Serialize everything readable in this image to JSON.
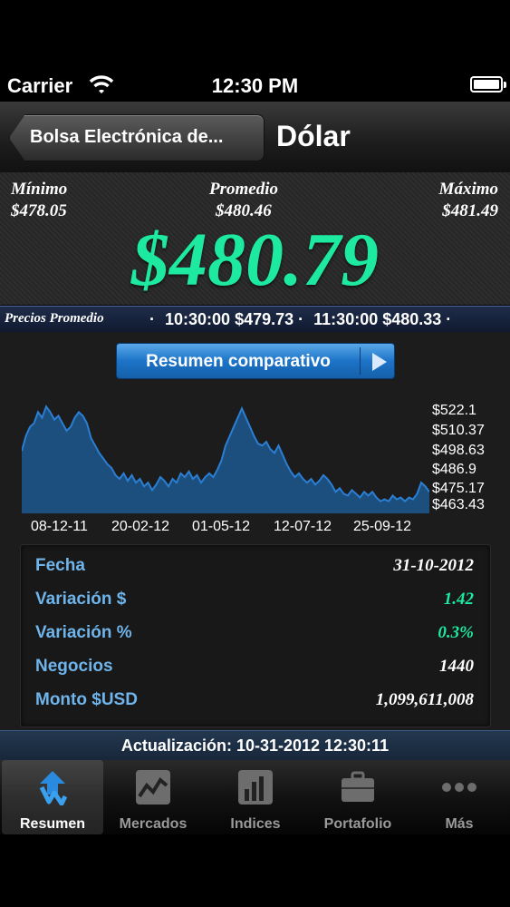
{
  "status": {
    "carrier": "Carrier",
    "time": "12:30 PM"
  },
  "nav": {
    "back_label": "Bolsa Electrónica de...",
    "title": "Dólar"
  },
  "stats": {
    "min_label": "Mínimo",
    "min_value": "$478.05",
    "avg_label": "Promedio",
    "avg_value": "$480.46",
    "max_label": "Máximo",
    "max_value": "$481.49",
    "current": "$480.79"
  },
  "ticker": {
    "label": "Precios Promedio",
    "items": [
      "·",
      "10:30:00 $479.73 ·",
      "11:30:00 $480.33 ·"
    ]
  },
  "resumen_button": "Resumen comparativo",
  "chart_data": {
    "type": "area",
    "x_ticks": [
      "08-12-11",
      "20-02-12",
      "01-05-12",
      "12-07-12",
      "25-09-12"
    ],
    "y_ticks": [
      "$522.1",
      "$510.37",
      "$498.63",
      "$486.9",
      "$475.17",
      "$463.43"
    ],
    "ylim": [
      463.43,
      522.1
    ],
    "values": [
      497,
      505,
      510,
      512,
      518,
      515,
      521,
      518,
      514,
      516,
      512,
      508,
      510,
      515,
      518,
      516,
      512,
      504,
      500,
      496,
      493,
      490,
      488,
      484,
      482,
      485,
      481,
      484,
      480,
      482,
      478,
      480,
      476,
      479,
      483,
      481,
      478,
      482,
      480,
      485,
      483,
      486,
      482,
      484,
      480,
      483,
      485,
      483,
      487,
      492,
      500,
      505,
      510,
      515,
      520,
      515,
      510,
      505,
      501,
      500,
      502,
      498,
      496,
      500,
      495,
      490,
      486,
      483,
      485,
      482,
      480,
      482,
      479,
      481,
      484,
      482,
      479,
      475,
      477,
      474,
      473,
      476,
      474,
      472,
      475,
      473,
      475,
      472,
      470,
      471,
      470,
      473,
      471,
      472,
      470,
      472,
      471,
      474,
      480,
      478,
      475
    ],
    "grid": false
  },
  "details": {
    "rows": [
      {
        "key": "Fecha",
        "value": "31-10-2012"
      },
      {
        "key": "Variación $",
        "value": "1.42"
      },
      {
        "key": "Variación %",
        "value": "0.3%"
      },
      {
        "key": "Negocios",
        "value": "1440"
      },
      {
        "key": "Monto $USD",
        "value": "1,099,611,008"
      }
    ]
  },
  "update": "Actualización: 10-31-2012 12:30:11",
  "tabs": [
    {
      "label": "Resumen",
      "icon": "resumen-icon",
      "active": true
    },
    {
      "label": "Mercados",
      "icon": "chart-line-icon",
      "active": false
    },
    {
      "label": "Indices",
      "icon": "bar-chart-icon",
      "active": false
    },
    {
      "label": "Portafolio",
      "icon": "briefcase-icon",
      "active": false
    },
    {
      "label": "Más",
      "icon": "more-dots-icon",
      "active": false
    }
  ],
  "colors": {
    "accent_green": "#1de9a0",
    "label_blue": "#6fb4ea",
    "chart_blue": "#2a7fd4"
  }
}
